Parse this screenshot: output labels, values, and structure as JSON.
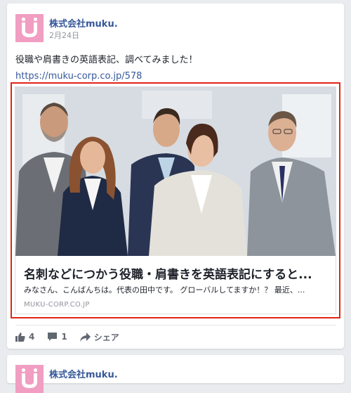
{
  "post": {
    "page_name": "株式会社muku.",
    "date": "2月24日",
    "text": "役職や肩書きの英語表記、調べてみました！",
    "link": "https://muku-corp.co.jp/578"
  },
  "link_card": {
    "title": "名刺などにつかう役職・肩書きを英語表記にすると...",
    "description": "みなさん、こんばんちは。代表の田中です。 グローバルしてますか！？ 最近、...",
    "domain": "MUKU-CORP.CO.JP"
  },
  "actions": {
    "like_count": "4",
    "comment_count": "1",
    "share_label": "シェア"
  },
  "next_post": {
    "page_name": "株式会社muku."
  },
  "colors": {
    "brand_pink": "#f19ec2",
    "link_blue": "#365899",
    "highlight_red": "#e2231a"
  }
}
